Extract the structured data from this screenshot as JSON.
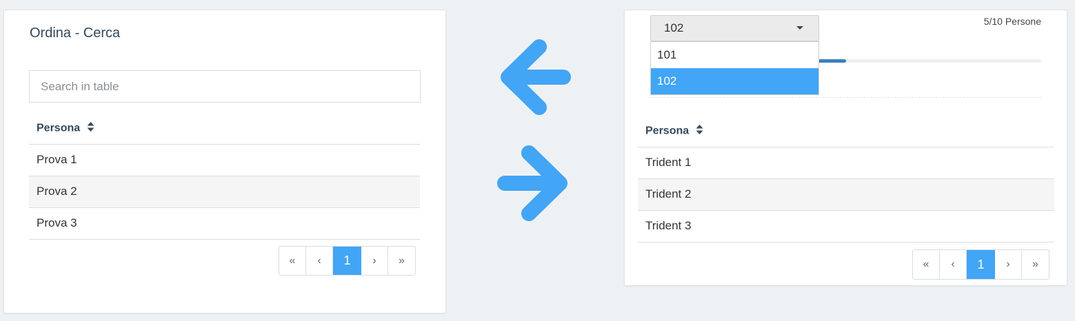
{
  "left": {
    "title": "Ordina - Cerca",
    "search_placeholder": "Search in table",
    "column_header": "Persona",
    "rows": [
      "Prova 1",
      "Prova 2",
      "Prova 3"
    ],
    "pagination": [
      "«",
      "‹",
      "1",
      "›",
      "»"
    ]
  },
  "right": {
    "select_value": "102",
    "options": [
      "101",
      "102"
    ],
    "selected_option": "102",
    "progress_label": "5/10 Persone",
    "progress_value": 0.5,
    "column_header": "Persona",
    "rows": [
      "Trident 1",
      "Trident 2",
      "Trident 3"
    ],
    "pagination": [
      "«",
      "‹",
      "1",
      "›",
      "»"
    ]
  },
  "colors": {
    "accent": "#42a5f5",
    "heading": "#34495e",
    "progress": "#3a80c0"
  },
  "icons": {
    "arrow_left": "arrow-left-icon",
    "arrow_right": "arrow-right-icon",
    "sort": "sort-icon",
    "caret": "caret-down-icon"
  }
}
